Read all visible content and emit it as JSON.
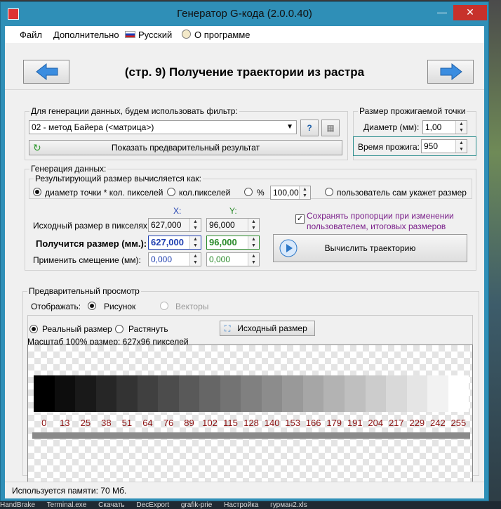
{
  "window": {
    "title": "Генератор G-кода (2.0.0.40)"
  },
  "menu": {
    "file": "Файл",
    "extra": "Дополнительно",
    "language": "Русский",
    "about": "О программе"
  },
  "nav": {
    "page_title": "(стр. 9) Получение траектории из растра"
  },
  "filter": {
    "legend": "Для генерации данных, будем использовать фильтр:",
    "selected": "02 - метод Байера (<матрица>)",
    "preview_button": "Показать предварительный результат"
  },
  "dot": {
    "legend": "Размер прожигаемой точки",
    "diameter_label": "Диаметр (мм):",
    "diameter_value": "1,00",
    "burn_label": "Время прожига:",
    "burn_value": "950"
  },
  "generation": {
    "legend": "Генерация данных:",
    "calc_legend": "Результирующий размер вычисляется как:",
    "opt_dot": "диаметр точки * кол. пикселей",
    "opt_pixels": "кол.пикселей",
    "opt_percent": "%",
    "percent_value": "100,00",
    "opt_user": "пользователь сам укажет размер",
    "x_header": "X:",
    "y_header": "Y:",
    "source_label": "Исходный размер в пикселях:",
    "source_x": "627,000",
    "source_y": "96,000",
    "result_label": "Получится размер (мм.):",
    "result_x": "627,000",
    "result_y": "96,000",
    "offset_label": "Применить смещение (мм):",
    "offset_x": "0,000",
    "offset_y": "0,000",
    "keep_proportions": "Сохранять пропорции при изменении пользователем, итоговых размеров",
    "calc_button": "Вычислить траекторию"
  },
  "preview": {
    "legend": "Предварительный просмотр",
    "display_label": "Отображать:",
    "opt_image": "Рисунок",
    "opt_vectors": "Векторы",
    "opt_real": "Реальный размер",
    "opt_stretch": "Растянуть",
    "source_size_button": "Исходный размер",
    "scale_text": "Масштаб 100% размер: 627x96 пикселей",
    "levels": [
      "0",
      "13",
      "25",
      "38",
      "51",
      "64",
      "76",
      "89",
      "102",
      "115",
      "128",
      "140",
      "153",
      "166",
      "179",
      "191",
      "204",
      "217",
      "229",
      "242",
      "255"
    ]
  },
  "status": {
    "memory": "Используется памяти:  70  Мб."
  },
  "taskbar": {
    "items": [
      "HandBrake",
      "Terminal.exe",
      "Скачать",
      "DecExport",
      "grafik-prie",
      "Настройка",
      "гурман2.xls"
    ]
  },
  "colors": {
    "accent": "#2f8fb7",
    "x_label": "#1f3fb0",
    "y_label": "#2a8a2a",
    "proportion_text": "#7a1f8a",
    "levels_text": "#8b1010"
  }
}
